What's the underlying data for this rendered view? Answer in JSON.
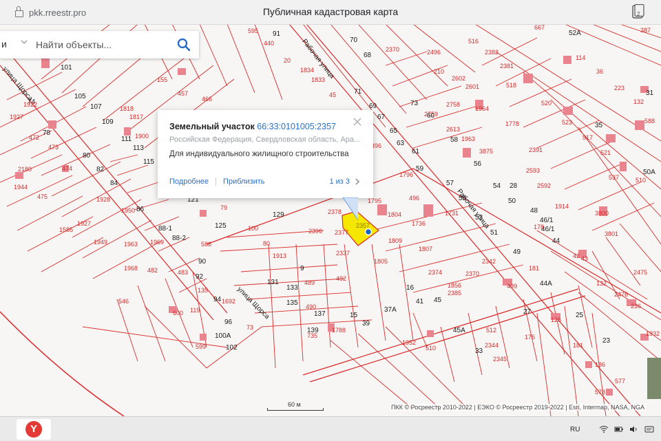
{
  "browser": {
    "url": "pkk.rreestr.pro",
    "page_title": "Публичная кадастровая карта",
    "tab_count": "2"
  },
  "search": {
    "left_fragment": "и",
    "placeholder": "Найти объекты..."
  },
  "popup": {
    "title": "Земельный участок",
    "cadastral_number": "66:33:0101005:2357",
    "address": "Российская Федерация, Свердловская область, Ара...",
    "purpose": "Для индивидуального жилищного строительства",
    "details_link": "Подробнее",
    "zoom_link": "Приблизить",
    "pager": "1 из 3"
  },
  "map": {
    "streets": [
      "улица Щорса",
      "улица Щорса",
      "Рабочая улица",
      "Рабочая улица"
    ],
    "selected_parcel": "2357",
    "labels": [
      "91",
      "70",
      "68",
      "98",
      "101",
      "103",
      "105",
      "107",
      "109",
      "111",
      "113",
      "115",
      "74",
      "78",
      "80",
      "82",
      "84",
      "86",
      "88-1",
      "88-2",
      "90",
      "92",
      "94",
      "96",
      "98",
      "100A",
      "102",
      "121",
      "125",
      "129",
      "131",
      "133",
      "135",
      "137",
      "139",
      "9",
      "15",
      "39",
      "37А",
      "16",
      "41",
      "45",
      "50",
      "48",
      "46/1",
      "46/1",
      "44",
      "49",
      "51",
      "53",
      "55",
      "57",
      "59",
      "61",
      "63",
      "65",
      "67",
      "69",
      "71",
      "85",
      "87",
      "89",
      "75",
      "73",
      "60",
      "58",
      "56",
      "54",
      "52A",
      "23",
      "25",
      "27",
      "29",
      "31",
      "33",
      "35",
      "50A",
      "44A",
      "45A",
      "35",
      "37",
      "23",
      "27",
      "29",
      "31",
      "33",
      "24",
      "26",
      "28",
      "8",
      "12",
      "10"
    ],
    "parcel_numbers": [
      "595",
      "440",
      "20",
      "1834",
      "1833",
      "45",
      "2370",
      "2496",
      "210",
      "2602",
      "2601",
      "2382",
      "2381",
      "667",
      "516",
      "114",
      "36",
      "223",
      "132",
      "588",
      "387",
      "23",
      "1922",
      "1927",
      "472",
      "473",
      "474",
      "2180",
      "1944",
      "475",
      "1928",
      "1927",
      "1585",
      "1949",
      "1950",
      "1963",
      "1968",
      "1969",
      "482",
      "483",
      "546",
      "1818",
      "1817",
      "1900",
      "155",
      "457",
      "466",
      "2759",
      "2758",
      "2613",
      "1963",
      "1964",
      "3875",
      "2391",
      "2593",
      "2592",
      "518",
      "520",
      "523",
      "517",
      "521",
      "537",
      "510",
      "1778",
      "2496",
      "1796",
      "1795",
      "1804",
      "1809",
      "1805",
      "1807",
      "1736",
      "1731",
      "496",
      "2374",
      "2370",
      "2342",
      "1856",
      "2385",
      "499",
      "181",
      "178",
      "1914",
      "3800",
      "3801",
      "42",
      "43",
      "132",
      "2475",
      "2476",
      "1932",
      "236",
      "2378",
      "2377",
      "2337",
      "2396",
      "1913",
      "489",
      "490",
      "492",
      "735",
      "1788",
      "100",
      "80",
      "79",
      "588",
      "600",
      "119",
      "135",
      "1692",
      "599",
      "73",
      "1952",
      "512",
      "2344",
      "2345",
      "510",
      "175",
      "126",
      "181",
      "186",
      "577",
      "578"
    ]
  },
  "scale_label": "60 м",
  "attribution": "ПКК © Росреестр 2010-2022 | ЕЭКО © Росреестр 2019-2022 | Esri, Intermap, NASA, NGA",
  "taskbar": {
    "language": "RU"
  },
  "colors": {
    "parcel_line": "#d92b2b",
    "selected_fill": "#f5e700",
    "link": "#2a6fc9"
  }
}
